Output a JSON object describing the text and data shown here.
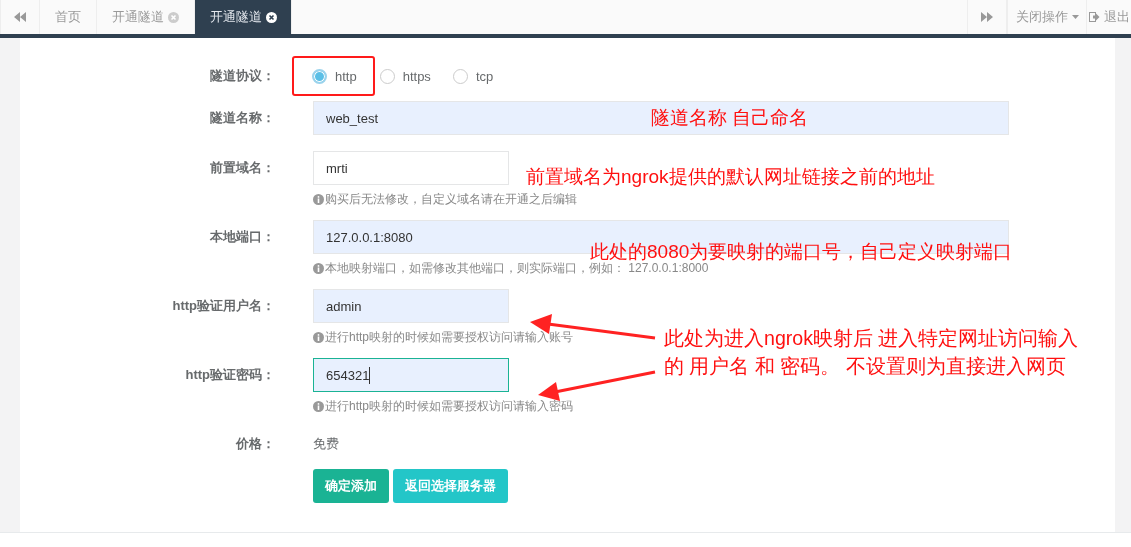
{
  "top_bar": {
    "tabs": [
      {
        "label": "首页",
        "closable": false,
        "selected": false
      },
      {
        "label": "开通隧道",
        "closable": true,
        "selected": false
      },
      {
        "label": "开通隧道",
        "closable": true,
        "selected": true
      }
    ],
    "menus": [
      {
        "label": "关闭操作",
        "kind": "dropdown"
      },
      {
        "label": "退出",
        "kind": "logout"
      }
    ]
  },
  "form": {
    "rows": [
      {
        "kind": "radio",
        "label": "隧道协议：",
        "options": [
          {
            "label": "http",
            "selected": true,
            "highlighted": true
          },
          {
            "label": "https",
            "selected": false,
            "highlighted": false
          },
          {
            "label": "tcp",
            "selected": false,
            "highlighted": false
          }
        ]
      },
      {
        "kind": "input",
        "label": "隧道名称：",
        "value": "web_test",
        "short": false,
        "autofilled": true,
        "focused": false
      },
      {
        "kind": "input",
        "label": "前置域名：",
        "value": "mrti",
        "short": true,
        "autofilled": false,
        "focused": false,
        "hint": "购买后无法修改，自定义域名请在开通之后编辑"
      },
      {
        "kind": "input",
        "label": "本地端口：",
        "value": "127.0.0.1:8080",
        "short": false,
        "autofilled": true,
        "focused": false,
        "hint": "本地映射端口，如需修改其他端口，则实际端口，例如： 127.0.0.1:8000"
      },
      {
        "kind": "input",
        "label": "http验证用户名：",
        "value": "admin",
        "short": true,
        "autofilled": true,
        "focused": false,
        "hint": "进行http映射的时候如需要授权访问请输入账号"
      },
      {
        "kind": "input",
        "label": "http验证密码：",
        "value": "654321",
        "short": true,
        "autofilled": true,
        "focused": true,
        "hint": "进行http映射的时候如需要授权访问请输入密码"
      },
      {
        "kind": "static",
        "label": "价格：",
        "value": "免费"
      }
    ],
    "buttons": [
      {
        "label": "确定添加",
        "kind": "primary"
      },
      {
        "label": "返回选择服务器",
        "kind": "info"
      }
    ]
  },
  "annotations": [
    {
      "text": "隧道名称 自己命名"
    },
    {
      "text": "前置域名为ngrok提供的默认网址链接之前的地址"
    },
    {
      "text": "此处的8080为要映射的端口号，自己定义映射端口"
    },
    {
      "text": "此处为进入ngrok映射后 进入特定网址访问输入的  用户名 和 密码。 不设置则为直接进入网页"
    }
  ]
}
